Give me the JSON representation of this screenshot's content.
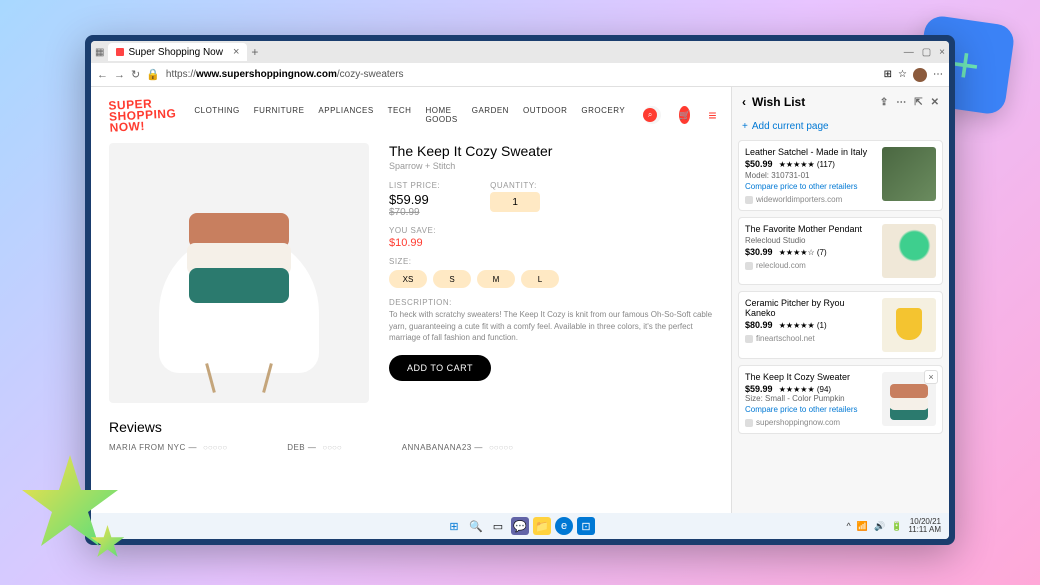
{
  "browser": {
    "tab_title": "Super Shopping Now",
    "url_prefix": "https://",
    "url_host": "www.supershoppingnow.com",
    "url_path": "/cozy-sweaters"
  },
  "logo_lines": [
    "SUPER",
    "SHOPPING",
    "NOW!"
  ],
  "nav": [
    "CLOTHING",
    "FURNITURE",
    "APPLIANCES",
    "TECH",
    "HOME GOODS",
    "GARDEN",
    "OUTDOOR",
    "GROCERY"
  ],
  "product": {
    "title": "The Keep It Cozy Sweater",
    "brand": "Sparrow + Stitch",
    "list_price_label": "LIST PRICE:",
    "price": "$59.99",
    "price_strike": "$70.99",
    "qty_label": "QUANTITY:",
    "qty": "1",
    "save_label": "YOU SAVE:",
    "save": "$10.99",
    "size_label": "SIZE:",
    "sizes": [
      "XS",
      "S",
      "M",
      "L"
    ],
    "desc_label": "DESCRIPTION:",
    "desc": "To heck with scratchy sweaters! The Keep It Cozy is knit from our famous Oh-So-Soft cable yarn, guaranteeing a cute fit with a comfy feel. Available in three colors, it's the perfect marriage of fall fashion and function.",
    "add_to_cart": "ADD TO CART"
  },
  "reviews": {
    "title": "Reviews",
    "items": [
      {
        "name": "MARIA FROM NYC —",
        "dots": "○○○○○"
      },
      {
        "name": "DEB —",
        "dots": "○○○○"
      },
      {
        "name": "ANNABANANA23 —",
        "dots": "○○○○○"
      }
    ]
  },
  "wishlist": {
    "title": "Wish List",
    "add_label": "Add current page",
    "items": [
      {
        "title": "Leather Satchel - Made in Italy",
        "price": "$50.99",
        "stars": "★★★★★",
        "count": "(117)",
        "model": "Model: 310731-01",
        "link": "Compare price to other retailers",
        "site": "wideworldimporters.com",
        "img": "bag"
      },
      {
        "title": "The Favorite Mother Pendant",
        "sub": "Relecloud Studio",
        "price": "$30.99",
        "stars": "★★★★☆",
        "count": "(7)",
        "site": "relecloud.com",
        "img": "pendant"
      },
      {
        "title": "Ceramic Pitcher by Ryou Kaneko",
        "price": "$80.99",
        "stars": "★★★★★",
        "count": "(1)",
        "site": "fineartschool.net",
        "img": "pitcher"
      },
      {
        "title": "The Keep It Cozy Sweater",
        "price": "$59.99",
        "stars": "★★★★★",
        "count": "(94)",
        "sub2": "Size: Small - Color Pumpkin",
        "link": "Compare price to other retailers",
        "site": "supershoppingnow.com",
        "img": "sweater",
        "x": true
      }
    ]
  },
  "taskbar": {
    "date": "10/20/21",
    "time": "11:11 AM"
  }
}
